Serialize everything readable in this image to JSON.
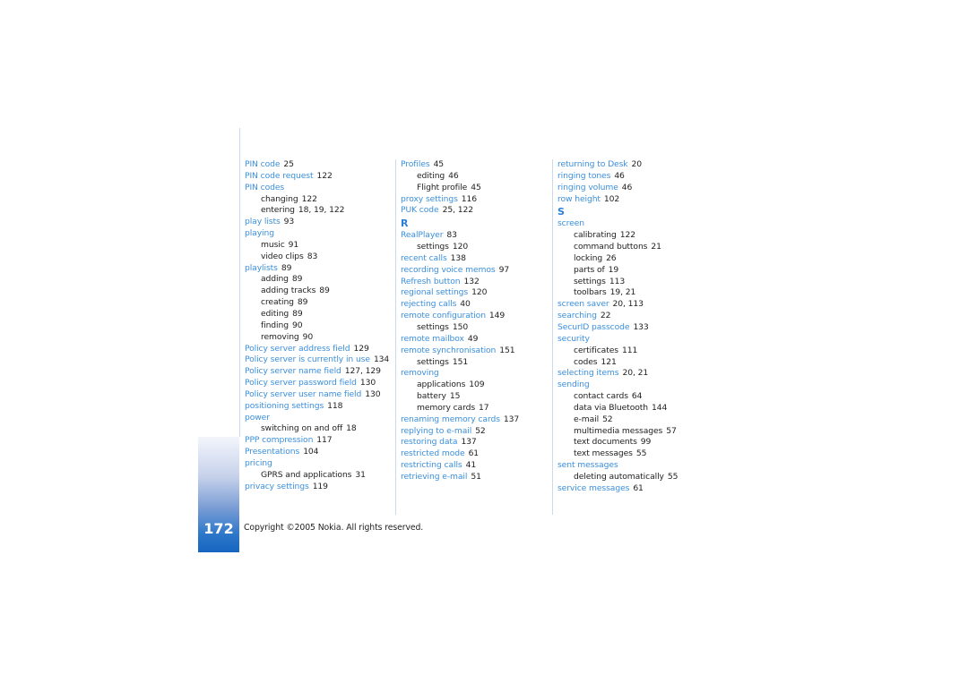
{
  "colors": {
    "term_blue": "#3b8fdc",
    "letter_blue": "#2a7fd4",
    "text": "#222222",
    "tab_blue": "#1565c0",
    "rule": "#c9d9ee"
  },
  "columns": [
    {
      "entries": [
        {
          "type": "main",
          "term": "PIN code",
          "pages": "25"
        },
        {
          "type": "main",
          "term": "PIN code request",
          "pages": "122"
        },
        {
          "type": "main",
          "term": "PIN codes",
          "pages": ""
        },
        {
          "type": "sub",
          "term": "changing",
          "pages": "122"
        },
        {
          "type": "sub",
          "term": "entering",
          "pages": "18, 19, 122"
        },
        {
          "type": "main",
          "term": "play lists",
          "pages": "93"
        },
        {
          "type": "main",
          "term": "playing",
          "pages": ""
        },
        {
          "type": "sub",
          "term": "music",
          "pages": "91"
        },
        {
          "type": "sub",
          "term": "video clips",
          "pages": "83"
        },
        {
          "type": "main",
          "term": "playlists",
          "pages": "89"
        },
        {
          "type": "sub",
          "term": "adding",
          "pages": "89"
        },
        {
          "type": "sub",
          "term": "adding tracks",
          "pages": "89"
        },
        {
          "type": "sub",
          "term": "creating",
          "pages": "89"
        },
        {
          "type": "sub",
          "term": "editing",
          "pages": "89"
        },
        {
          "type": "sub",
          "term": "finding",
          "pages": "90"
        },
        {
          "type": "sub",
          "term": "removing",
          "pages": "90"
        },
        {
          "type": "main",
          "term": "Policy server address field",
          "pages": "129"
        },
        {
          "type": "main",
          "term": "Policy server is currently in use",
          "pages": "134"
        },
        {
          "type": "main",
          "term": "Policy server name field",
          "pages": "127, 129"
        },
        {
          "type": "main",
          "term": "Policy server password field",
          "pages": "130"
        },
        {
          "type": "main",
          "term": "Policy server user name field",
          "pages": "130"
        },
        {
          "type": "main",
          "term": "positioning settings",
          "pages": "118"
        },
        {
          "type": "main",
          "term": "power",
          "pages": ""
        },
        {
          "type": "sub",
          "term": "switching on and off",
          "pages": "18"
        },
        {
          "type": "main",
          "term": "PPP compression",
          "pages": "117"
        },
        {
          "type": "main",
          "term": "Presentations",
          "pages": "104"
        },
        {
          "type": "main",
          "term": "pricing",
          "pages": ""
        },
        {
          "type": "sub",
          "term": "GPRS and applications",
          "pages": "31"
        },
        {
          "type": "main",
          "term": "privacy settings",
          "pages": "119"
        }
      ]
    },
    {
      "entries": [
        {
          "type": "main",
          "term": "Profiles",
          "pages": "45"
        },
        {
          "type": "sub",
          "term": "editing",
          "pages": "46"
        },
        {
          "type": "sub",
          "term": "Flight profile",
          "pages": "45"
        },
        {
          "type": "main",
          "term": "proxy settings",
          "pages": "116"
        },
        {
          "type": "main",
          "term": "PUK code",
          "pages": "25, 122"
        },
        {
          "type": "letter",
          "term": "R",
          "pages": ""
        },
        {
          "type": "main",
          "term": "RealPlayer",
          "pages": "83"
        },
        {
          "type": "sub",
          "term": "settings",
          "pages": "120"
        },
        {
          "type": "main",
          "term": "recent calls",
          "pages": "138"
        },
        {
          "type": "main",
          "term": "recording voice memos",
          "pages": "97"
        },
        {
          "type": "main",
          "term": "Refresh button",
          "pages": "132"
        },
        {
          "type": "main",
          "term": "regional settings",
          "pages": "120"
        },
        {
          "type": "main",
          "term": "rejecting calls",
          "pages": "40"
        },
        {
          "type": "main",
          "term": "remote configuration",
          "pages": "149"
        },
        {
          "type": "sub",
          "term": "settings",
          "pages": "150"
        },
        {
          "type": "main",
          "term": "remote mailbox",
          "pages": "49"
        },
        {
          "type": "main",
          "term": "remote synchronisation",
          "pages": "151"
        },
        {
          "type": "sub",
          "term": "settings",
          "pages": "151"
        },
        {
          "type": "main",
          "term": "removing",
          "pages": ""
        },
        {
          "type": "sub",
          "term": "applications",
          "pages": "109"
        },
        {
          "type": "sub",
          "term": "battery",
          "pages": "15"
        },
        {
          "type": "sub",
          "term": "memory cards",
          "pages": "17"
        },
        {
          "type": "main",
          "term": "renaming memory cards",
          "pages": "137"
        },
        {
          "type": "main",
          "term": "replying to e-mail",
          "pages": "52"
        },
        {
          "type": "main",
          "term": "restoring data",
          "pages": "137"
        },
        {
          "type": "main",
          "term": "restricted mode",
          "pages": "61"
        },
        {
          "type": "main",
          "term": "restricting calls",
          "pages": "41"
        },
        {
          "type": "main",
          "term": "retrieving e-mail",
          "pages": "51"
        }
      ]
    },
    {
      "entries": [
        {
          "type": "main",
          "term": "returning to Desk",
          "pages": "20"
        },
        {
          "type": "main",
          "term": "ringing tones",
          "pages": "46"
        },
        {
          "type": "main",
          "term": "ringing volume",
          "pages": "46"
        },
        {
          "type": "main",
          "term": "row height",
          "pages": "102"
        },
        {
          "type": "letter",
          "term": "S",
          "pages": ""
        },
        {
          "type": "main",
          "term": "screen",
          "pages": ""
        },
        {
          "type": "sub",
          "term": "calibrating",
          "pages": "122"
        },
        {
          "type": "sub",
          "term": "command buttons",
          "pages": "21"
        },
        {
          "type": "sub",
          "term": "locking",
          "pages": "26"
        },
        {
          "type": "sub",
          "term": "parts of",
          "pages": "19"
        },
        {
          "type": "sub",
          "term": "settings",
          "pages": "113"
        },
        {
          "type": "sub",
          "term": "toolbars",
          "pages": "19, 21"
        },
        {
          "type": "main",
          "term": "screen saver",
          "pages": "20, 113"
        },
        {
          "type": "main",
          "term": "searching",
          "pages": "22"
        },
        {
          "type": "main",
          "term": "SecurID passcode",
          "pages": "133"
        },
        {
          "type": "main",
          "term": "security",
          "pages": ""
        },
        {
          "type": "sub",
          "term": "certificates",
          "pages": "111"
        },
        {
          "type": "sub",
          "term": "codes",
          "pages": "121"
        },
        {
          "type": "main",
          "term": "selecting items",
          "pages": "20, 21"
        },
        {
          "type": "main",
          "term": "sending",
          "pages": ""
        },
        {
          "type": "sub",
          "term": "contact cards",
          "pages": "64"
        },
        {
          "type": "sub",
          "term": "data via Bluetooth",
          "pages": "144"
        },
        {
          "type": "sub",
          "term": "e-mail",
          "pages": "52"
        },
        {
          "type": "sub",
          "term": "multimedia messages",
          "pages": "57"
        },
        {
          "type": "sub",
          "term": "text documents",
          "pages": "99"
        },
        {
          "type": "sub",
          "term": "text messages",
          "pages": "55"
        },
        {
          "type": "main",
          "term": "sent messages",
          "pages": ""
        },
        {
          "type": "sub",
          "term": "deleting automatically",
          "pages": "55"
        },
        {
          "type": "main",
          "term": "service messages",
          "pages": "61"
        }
      ]
    }
  ],
  "footer": {
    "page_number": "172",
    "copyright": "Copyright ©2005 Nokia. All rights reserved."
  }
}
